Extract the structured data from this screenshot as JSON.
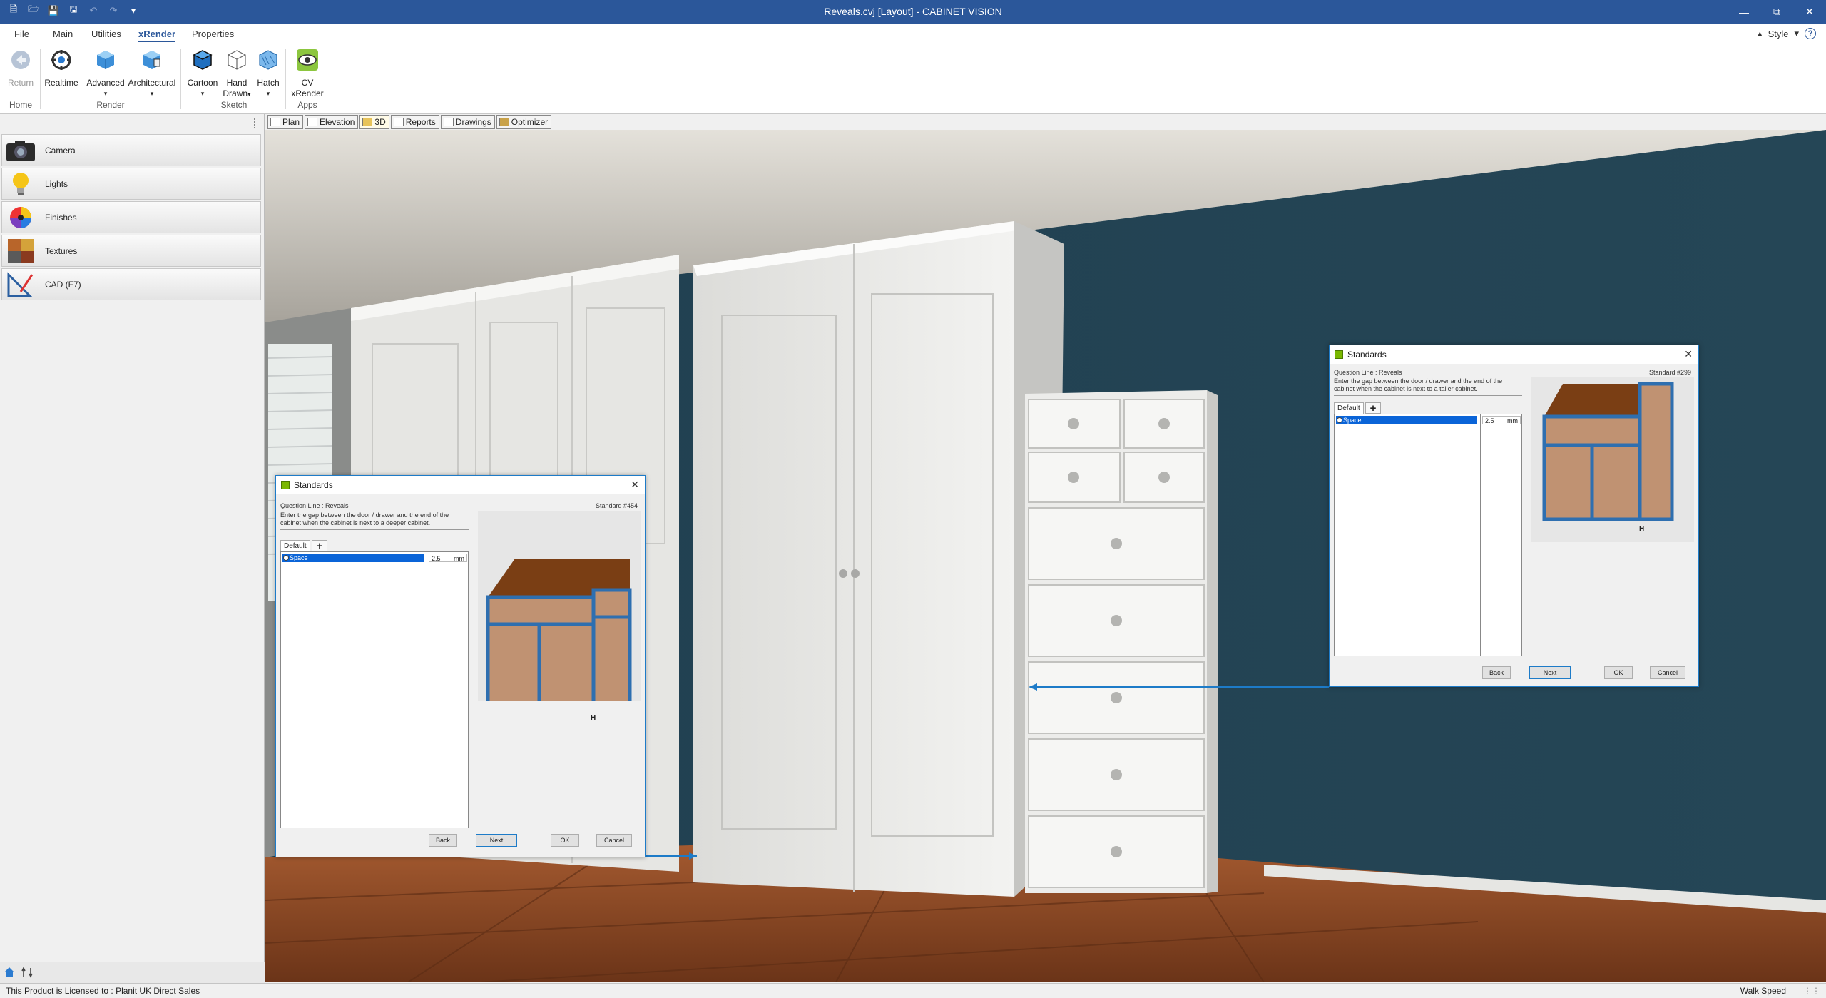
{
  "window": {
    "title": "Reveals.cvj [Layout] - CABINET VISION",
    "controls": [
      "minimize-icon",
      "restore-icon",
      "close-icon"
    ]
  },
  "ribbon": {
    "tabs": [
      {
        "label": "File",
        "active": false
      },
      {
        "label": "Main",
        "active": false
      },
      {
        "label": "Utilities",
        "active": false
      },
      {
        "label": "xRender",
        "active": true
      },
      {
        "label": "Properties",
        "active": false
      }
    ],
    "style_label": "Style",
    "groups": {
      "home": {
        "label": "Home",
        "buttons": [
          {
            "label": "Return",
            "disabled": true
          }
        ]
      },
      "render": {
        "label": "Render",
        "buttons": [
          {
            "label": "Realtime"
          },
          {
            "label": "Advanced"
          },
          {
            "label": "Architectural"
          }
        ]
      },
      "sketch": {
        "label": "Sketch",
        "buttons": [
          {
            "label": "Cartoon"
          },
          {
            "label": "Hand",
            "label2": "Drawn"
          },
          {
            "label": "Hatch"
          }
        ]
      },
      "apps": {
        "label": "Apps",
        "buttons": [
          {
            "label": "CV",
            "label2": "xRender"
          }
        ]
      }
    }
  },
  "left_panel": {
    "items": [
      {
        "label": "Camera",
        "icon": "camera-icon"
      },
      {
        "label": "Lights",
        "icon": "lightbulb-icon"
      },
      {
        "label": "Finishes",
        "icon": "color-wheel-icon"
      },
      {
        "label": "Textures",
        "icon": "textures-icon"
      },
      {
        "label": "CAD (F7)",
        "icon": "cad-ruler-icon"
      }
    ]
  },
  "view_tabs": [
    {
      "label": "Plan",
      "active": false
    },
    {
      "label": "Elevation",
      "active": false
    },
    {
      "label": "3D",
      "active": true
    },
    {
      "label": "Reports",
      "active": false
    },
    {
      "label": "Drawings",
      "active": false
    },
    {
      "label": "Optimizer",
      "active": false
    }
  ],
  "dialog_left": {
    "title": "Standards",
    "question_line": "Question Line : Reveals",
    "standard": "Standard #454",
    "description_line1": "Enter the gap between the door / drawer and the end of the",
    "description_line2": "cabinet when the cabinet is next to a deeper cabinet.",
    "tab": "Default",
    "row_label": "Space",
    "row_value": "2.5",
    "row_unit": "mm",
    "preview_label": "H",
    "buttons": {
      "back": "Back",
      "next": "Next",
      "ok": "OK",
      "cancel": "Cancel"
    }
  },
  "dialog_right": {
    "title": "Standards",
    "question_line": "Question Line : Reveals",
    "standard": "Standard #299",
    "description_line1": "Enter the gap between the door / drawer and the end of the",
    "description_line2": "cabinet when the cabinet is next to a taller cabinet.",
    "tab": "Default",
    "row_label": "Space",
    "row_value": "2.5",
    "row_unit": "mm",
    "preview_label": "H",
    "buttons": {
      "back": "Back",
      "next": "Next",
      "ok": "OK",
      "cancel": "Cancel"
    }
  },
  "status_bar": {
    "license": "This Product is Licensed to : Planit UK Direct Sales",
    "walk_speed": "Walk Speed"
  },
  "colors": {
    "title_bar": "#2b579a",
    "dialog_border": "#1d7bc8",
    "selection": "#0a64d8",
    "wall": "#1f3e4f",
    "cabinet": "#ececea",
    "wood_floor": "#8a4b2a",
    "preview_top": "#7a3e14",
    "preview_body": "#c09272",
    "preview_outline": "#2e6fb0"
  }
}
